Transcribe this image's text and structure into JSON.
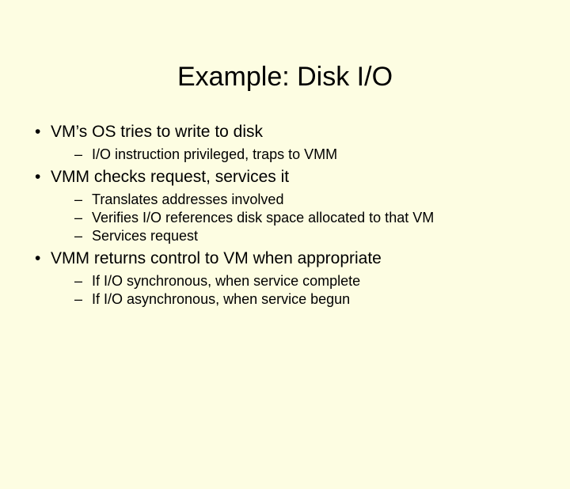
{
  "title": "Example: Disk I/O",
  "bullets": [
    {
      "text": "VM’s OS tries to write to disk",
      "sub": [
        "I/O instruction privileged, traps to VMM"
      ]
    },
    {
      "text": "VMM checks request, services it",
      "sub": [
        "Translates addresses involved",
        "Verifies I/O references disk space allocated to that VM",
        "Services request"
      ]
    },
    {
      "text": "VMM returns control to VM when appropriate",
      "sub": [
        "If I/O synchronous, when service complete",
        "If I/O asynchronous, when service begun"
      ]
    }
  ]
}
